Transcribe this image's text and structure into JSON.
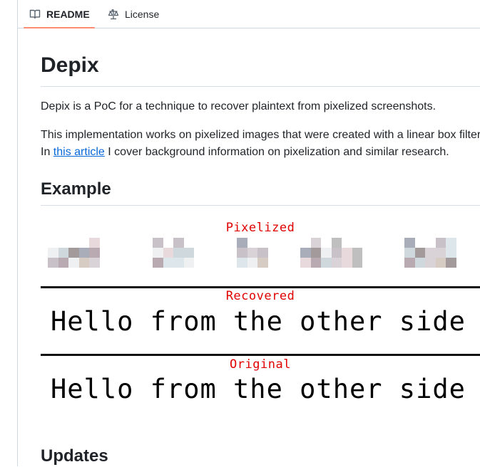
{
  "tabs": [
    {
      "label": "README",
      "icon": "book-icon",
      "active": true
    },
    {
      "label": "License",
      "icon": "law-icon",
      "active": false
    }
  ],
  "readme": {
    "title": "Depix",
    "intro": "Depix is a PoC for a technique to recover plaintext from pixelized screenshots.",
    "impl": "This implementation works on pixelized images that were created with a linear box filter.",
    "article_prefix": "In ",
    "article_link": "this article",
    "article_suffix": " I cover background information on pixelization and similar research.",
    "example_heading": "Example",
    "updates_heading": "Updates"
  },
  "demo": {
    "pixelized_label": "Pixelized",
    "recovered_label": "Recovered",
    "original_label": "Original",
    "recovered_text": "Hello from the other side",
    "original_text": "Hello from the other side",
    "label_color": "#e00000"
  }
}
